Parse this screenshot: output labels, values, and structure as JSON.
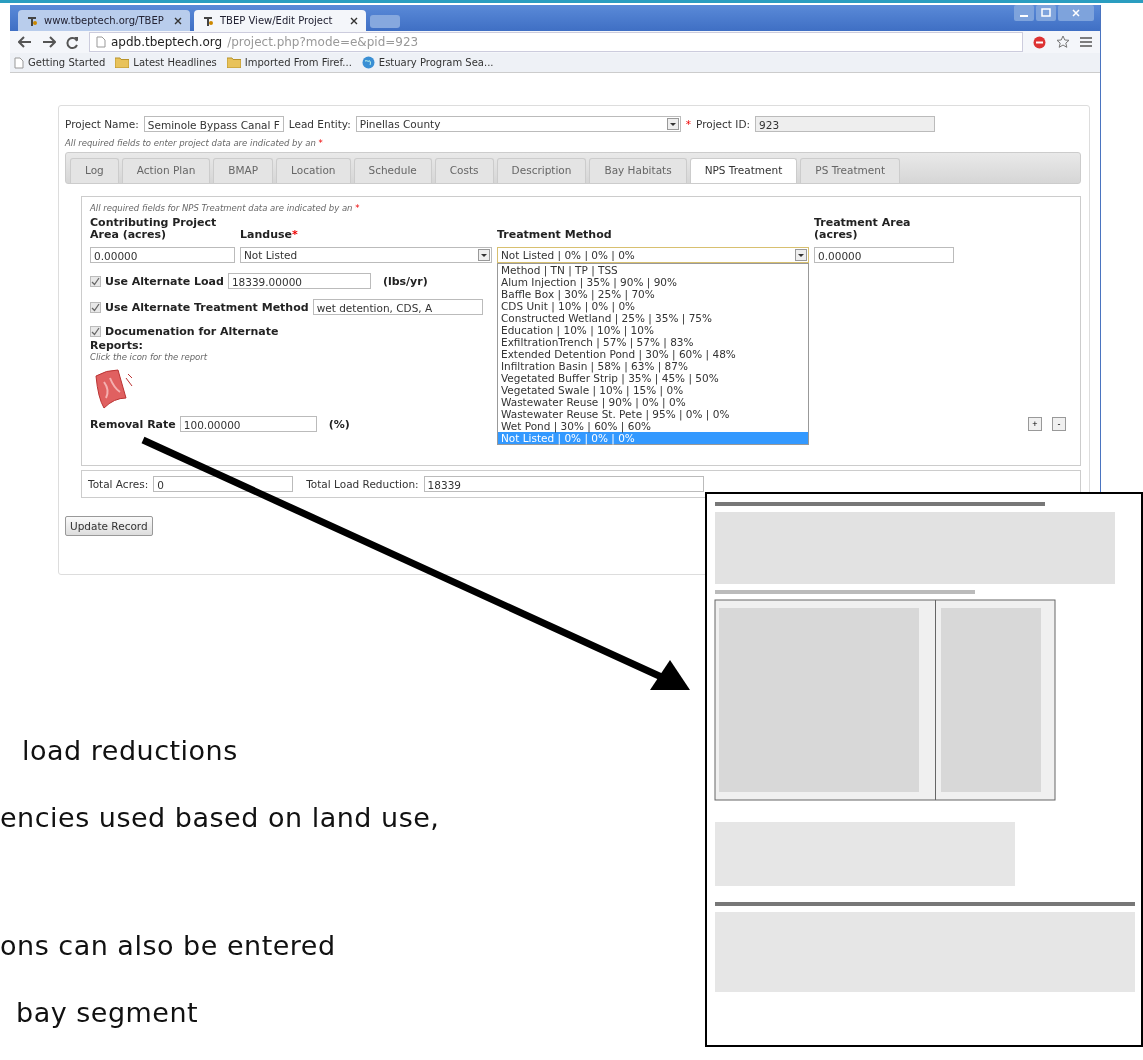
{
  "browser": {
    "tabs": [
      {
        "title": "www.tbeptech.org/TBEP",
        "selected": false
      },
      {
        "title": "TBEP View/Edit Project",
        "selected": true
      }
    ],
    "address": {
      "host": "apdb.tbeptech.org",
      "path": "/project.php?mode=e&pid=923"
    },
    "bookmarks": [
      {
        "label": "Getting Started",
        "kind": "page"
      },
      {
        "label": "Latest Headlines",
        "kind": "folder"
      },
      {
        "label": "Imported From Firef...",
        "kind": "folder"
      },
      {
        "label": "Estuary Program Sea...",
        "kind": "site"
      }
    ]
  },
  "project": {
    "name_label": "Project Name:",
    "name": "Seminole Bypass Canal F",
    "lead_label": "Lead Entity:",
    "lead": "Pinellas County",
    "required_mark": "*",
    "id_label": "Project ID:",
    "id": "923",
    "note": "All required fields to enter project data are indicated by an",
    "note_mark": "*"
  },
  "tabs": [
    {
      "label": "Log",
      "selected": false
    },
    {
      "label": "Action Plan",
      "selected": false
    },
    {
      "label": "BMAP",
      "selected": false
    },
    {
      "label": "Location",
      "selected": false
    },
    {
      "label": "Schedule",
      "selected": false
    },
    {
      "label": "Costs",
      "selected": false
    },
    {
      "label": "Description",
      "selected": false
    },
    {
      "label": "Bay Habitats",
      "selected": false
    },
    {
      "label": "NPS Treatment",
      "selected": true
    },
    {
      "label": "PS Treatment",
      "selected": false
    }
  ],
  "nps": {
    "note": "All required fields for NPS Treatment data are indicated by an",
    "note_mark": "*",
    "columns": [
      {
        "label": "Contributing Project Area (acres)"
      },
      {
        "label": "Landuse",
        "mark": "*"
      },
      {
        "label": "Treatment Method"
      },
      {
        "label": "Treatment Area (acres)"
      }
    ],
    "area": "0.00000",
    "landuse": "Not Listed",
    "treatment": "Not Listed | 0% | 0% | 0%",
    "treatment_area": "0.00000",
    "options": [
      {
        "label": "Method | TN | TP | TSS",
        "selected": false
      },
      {
        "label": "Alum Injection | 35% | 90% | 90%",
        "selected": false
      },
      {
        "label": "Baffle Box | 30% | 25% | 70%",
        "selected": false
      },
      {
        "label": "CDS Unit | 10% | 0% | 0%",
        "selected": false
      },
      {
        "label": "Constructed Wetland | 25% | 35% | 75%",
        "selected": false
      },
      {
        "label": "Education | 10% | 10% | 10%",
        "selected": false
      },
      {
        "label": "ExfiltrationTrench | 57% | 57% | 83%",
        "selected": false
      },
      {
        "label": "Extended Detention Pond | 30% | 60% | 48%",
        "selected": false
      },
      {
        "label": "Infiltration Basin | 58% | 63% | 87%",
        "selected": false
      },
      {
        "label": "Vegetated Buffer Strip | 35% | 45% | 50%",
        "selected": false
      },
      {
        "label": "Vegetated Swale | 10% | 15% | 0%",
        "selected": false
      },
      {
        "label": "Wastewater Reuse | 90% | 0% | 0%",
        "selected": false
      },
      {
        "label": "Wastewater Reuse St. Pete | 95% | 0% | 0%",
        "selected": false
      },
      {
        "label": "Wet Pond | 30% | 60% | 60%",
        "selected": false
      },
      {
        "label": "Not Listed | 0% | 0% | 0%",
        "selected": true
      }
    ],
    "alternates": [
      {
        "label": "Use Alternate Load",
        "checked": true,
        "value": "18339.00000",
        "unit": "(lbs/yr)"
      },
      {
        "label": "Use Alternate Treatment Method",
        "checked": true,
        "value": "wet detention, CDS, A"
      },
      {
        "label": "Documenation for Alternate",
        "checked": true
      }
    ],
    "reports_label": "Reports:",
    "reports_hint": "Click the icon for the report",
    "removal_label": "Removal Rate",
    "removal": "100.00000",
    "removal_unit": "(%)",
    "row_buttons": [
      "+",
      "-"
    ]
  },
  "totals": {
    "acres_label": "Total Acres:",
    "acres": "0",
    "load_label": "Total Load Reduction:",
    "load": "18339"
  },
  "update_button": "Update Record",
  "slide": {
    "lines": [
      "load reductions",
      "encies used based on land use,",
      "ons can also be entered",
      "bay segment"
    ]
  }
}
